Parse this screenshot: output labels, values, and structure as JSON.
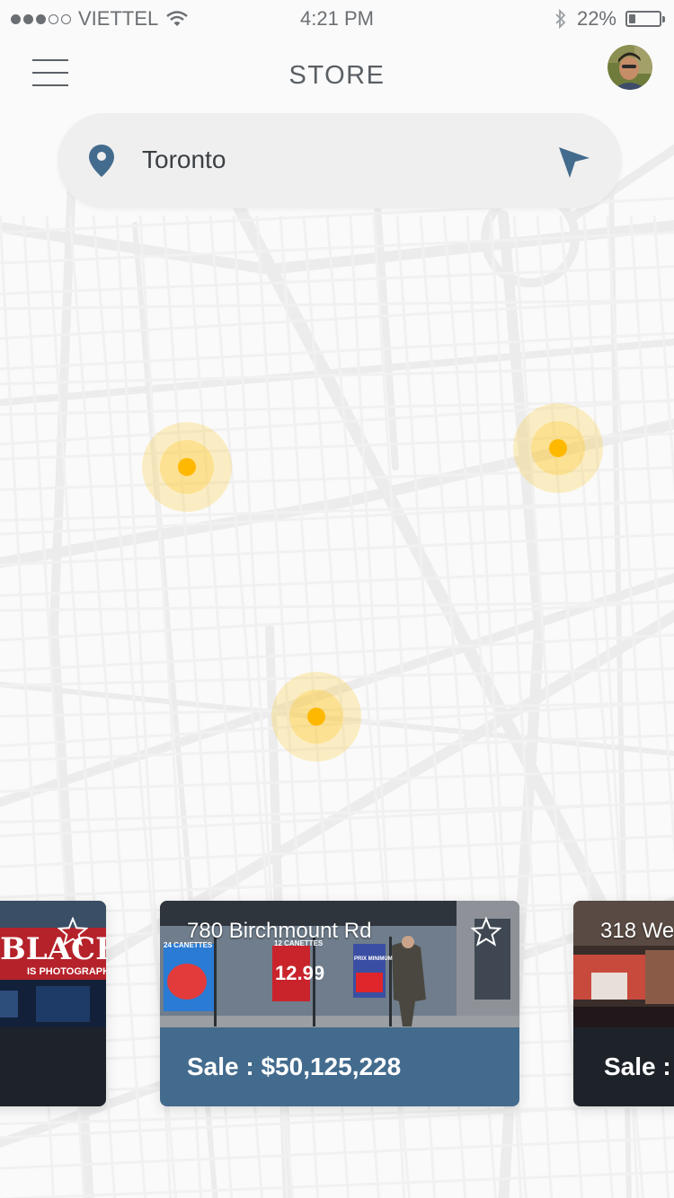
{
  "status_bar": {
    "carrier": "VIETTEL",
    "signal_bars": 3,
    "signal_max": 5,
    "time": "4:21 PM",
    "battery_percent": "22%",
    "battery_level": 0.22,
    "icons": [
      "wifi-icon",
      "bluetooth-icon",
      "battery-icon"
    ]
  },
  "header": {
    "title": "STORE",
    "menu_icon": "hamburger-icon",
    "avatar": "user-avatar"
  },
  "search": {
    "value": "Toronto",
    "placeholder": "",
    "icon_left": "location-pin-icon",
    "icon_right": "navigation-arrow-icon"
  },
  "map": {
    "marker_count": 3,
    "marker_icon": "store-marker",
    "colors": {
      "marker": "#ffc000",
      "marker_halo": "#ffe9a8",
      "roads": "#ececec",
      "background": "#fafafa"
    }
  },
  "stores": [
    {
      "address": "",
      "sale": "",
      "favorite_icon": "star-outline-icon",
      "image_text_1": "BLACK",
      "image_text_2": "IS PHOTOGRAPHY",
      "selected": false
    },
    {
      "address": "780 Birchmount Rd",
      "sale": "Sale : $50,125,228",
      "favorite_icon": "star-outline-icon",
      "image_text_1": "24 CANETTES",
      "image_text_2": "12 CANETTES",
      "image_text_3": "12.99",
      "image_text_4": "PRIX MINIMUM",
      "selected": true
    },
    {
      "address": "318 We",
      "sale": "Sale :",
      "favorite_icon": "star-outline-icon",
      "selected": false
    }
  ],
  "colors": {
    "accent": "#436b8d",
    "card_dark": "#1e2329",
    "text_muted": "#6b6f73",
    "search_bg": "#efefef"
  }
}
